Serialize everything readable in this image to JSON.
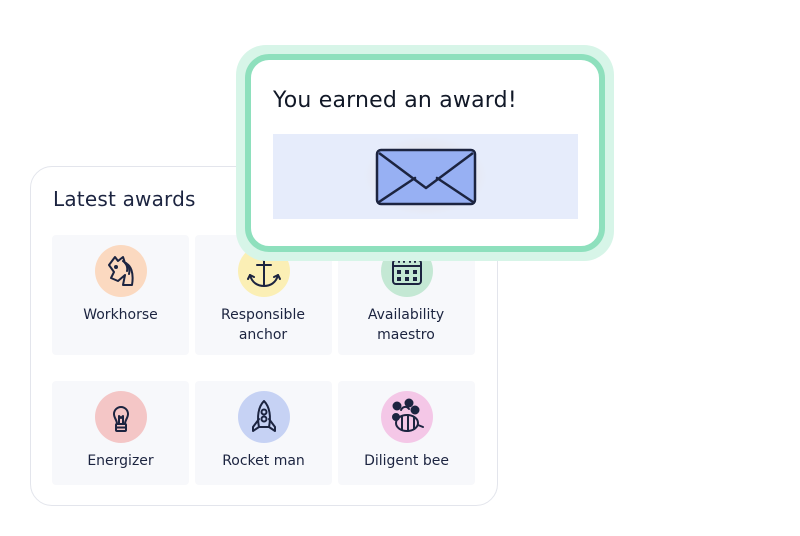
{
  "latest_awards": {
    "title": "Latest awards",
    "items": [
      {
        "label": "Workhorse",
        "icon": "horse-icon",
        "badge_color": "#fbd9c0"
      },
      {
        "label": "Responsible anchor",
        "icon": "anchor-icon",
        "badge_color": "#fbefb5"
      },
      {
        "label": "Availability maestro",
        "icon": "calendar-icon",
        "badge_color": "#c4e8d4"
      },
      {
        "label": "Energizer",
        "icon": "lightbulb-icon",
        "badge_color": "#f4c6c6"
      },
      {
        "label": "Rocket man",
        "icon": "rocket-icon",
        "badge_color": "#c6d2f4"
      },
      {
        "label": "Diligent bee",
        "icon": "bee-icon",
        "badge_color": "#f4c7e7"
      }
    ]
  },
  "modal": {
    "title": "You earned an award!",
    "icon": "envelope-icon"
  },
  "colors": {
    "modal_border": "#8ee0bd",
    "modal_halo": "#d7f5e8",
    "envelope_panel": "#e6ecfb",
    "envelope_fill": "#97b0f3",
    "text": "#1c2440"
  }
}
